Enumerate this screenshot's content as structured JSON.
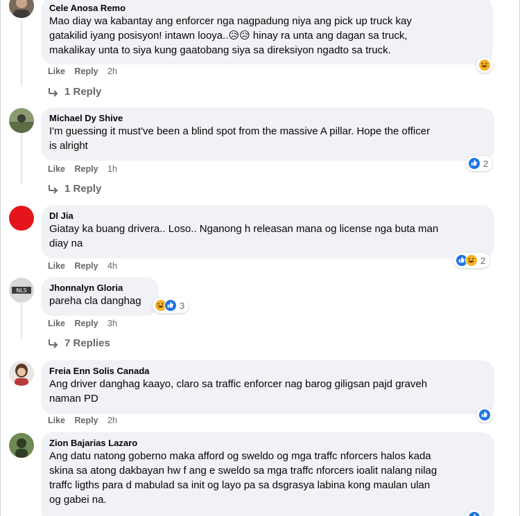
{
  "colors": {
    "bubble": "#f0f2f5",
    "meta_gray": "#65676b",
    "like_blue": "#1b74e4",
    "haha_yellow": "#f7b125",
    "avatar_red": "#e4161b"
  },
  "comments": [
    {
      "author": "Cele Anosa Remo",
      "lines": [
        "Mao diay wa kabantay ang enforcer nga nagpadung niya ang pick up truck kay",
        "gatakilid iyang posisyon! intawn looya..😥😥 hinay ra unta ang dagan sa truck,",
        "makalikay unta to siya kung gaatobang siya sa direksiyon ngadto sa truck."
      ],
      "like": "Like",
      "reply": "Reply",
      "time": "2h",
      "replies": "1 Reply",
      "reaction_icons": [
        "haha-icon"
      ],
      "reaction_count": ""
    },
    {
      "author": "Michael Dy Shive",
      "lines": [
        "I'm guessing it must've been a blind spot from the massive A pillar. Hope the officer",
        "is alright"
      ],
      "like": "Like",
      "reply": "Reply",
      "time": "1h",
      "replies": "1 Reply",
      "reaction_icons": [
        "like-icon"
      ],
      "reaction_count": "2"
    },
    {
      "author": "Dl Jia",
      "lines": [
        "Giatay ka buang drivera.. Loso.. Nganong h releasan mana og license nga buta man",
        "diay na"
      ],
      "like": "Like",
      "reply": "Reply",
      "time": "4h",
      "replies": "",
      "reaction_icons": [
        "like-icon",
        "haha-icon"
      ],
      "reaction_count": "2"
    },
    {
      "author": "Jhonnalyn Gloria",
      "lines": [
        "pareha cla danghag"
      ],
      "like": "Like",
      "reply": "Reply",
      "time": "3h",
      "replies": "7 Replies",
      "reaction_icons": [
        "haha-icon",
        "like-icon"
      ],
      "reaction_count": "3"
    },
    {
      "author": "Freia Enn Solis Canada",
      "lines": [
        "Ang driver danghag kaayo, claro sa traffic enforcer nag barog giligsan pajd graveh",
        "naman PD"
      ],
      "like": "Like",
      "reply": "Reply",
      "time": "2h",
      "replies": "",
      "reaction_icons": [
        "like-icon"
      ],
      "reaction_count": ""
    },
    {
      "author": "Zion Bajarias Lazaro",
      "lines": [
        "Ang datu natong goberno maka afford og sweldo og mga traffc nforcers halos kada",
        "skina sa atong dakbayan hw f ang e sweldo sa mga traffc nforcers ioalit nalang nilag",
        "traffc ligths para d mabulad sa init og layo pa sa dsgrasya labina kong maulan ulan",
        "og gabei na."
      ],
      "like": "",
      "reply": "",
      "time": "",
      "replies": "",
      "reaction_icons": [
        "like-icon"
      ],
      "reaction_count": ""
    }
  ]
}
